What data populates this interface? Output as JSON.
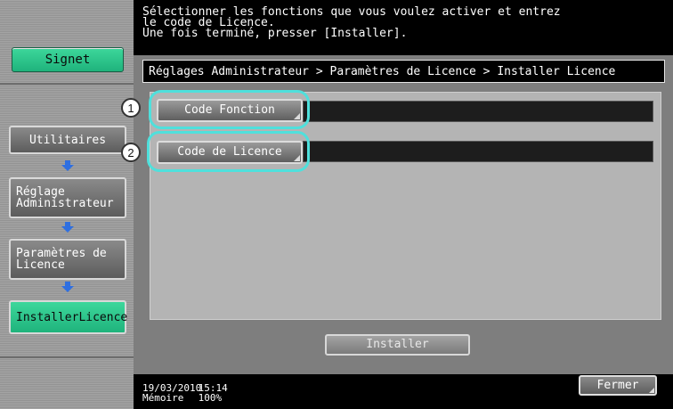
{
  "header": {
    "lines": [
      "Sélectionner les fonctions que vous voulez activer et entrez",
      "le code de Licence.",
      "Une fois terminé, presser [Installer]."
    ]
  },
  "sidebar": {
    "signet_label": "Signet",
    "items": [
      {
        "label": "Utilitaires"
      },
      {
        "label_line1": "Réglage",
        "label_line2": "Administrateur"
      },
      {
        "label_line1": "Paramètres de",
        "label_line2": "Licence"
      },
      {
        "label": "InstallerLicence"
      }
    ]
  },
  "breadcrumb": "Réglages Administrateur > Paramètres de Licence > Installer Licence",
  "functions": [
    {
      "badge": "1",
      "label": "Code Fonction",
      "value": ""
    },
    {
      "badge": "2",
      "label": "Code de Licence",
      "value": ""
    }
  ],
  "install_label": "Installer",
  "status": {
    "date": "19/03/2010",
    "time": "15:14",
    "memory_label": "Mémoire",
    "memory_value": "100%"
  },
  "close_label": "Fermer",
  "colors": {
    "accent_green": "#2ac58a",
    "callout_cyan": "#4fe0dc",
    "arrow_blue": "#2f6fe0"
  }
}
